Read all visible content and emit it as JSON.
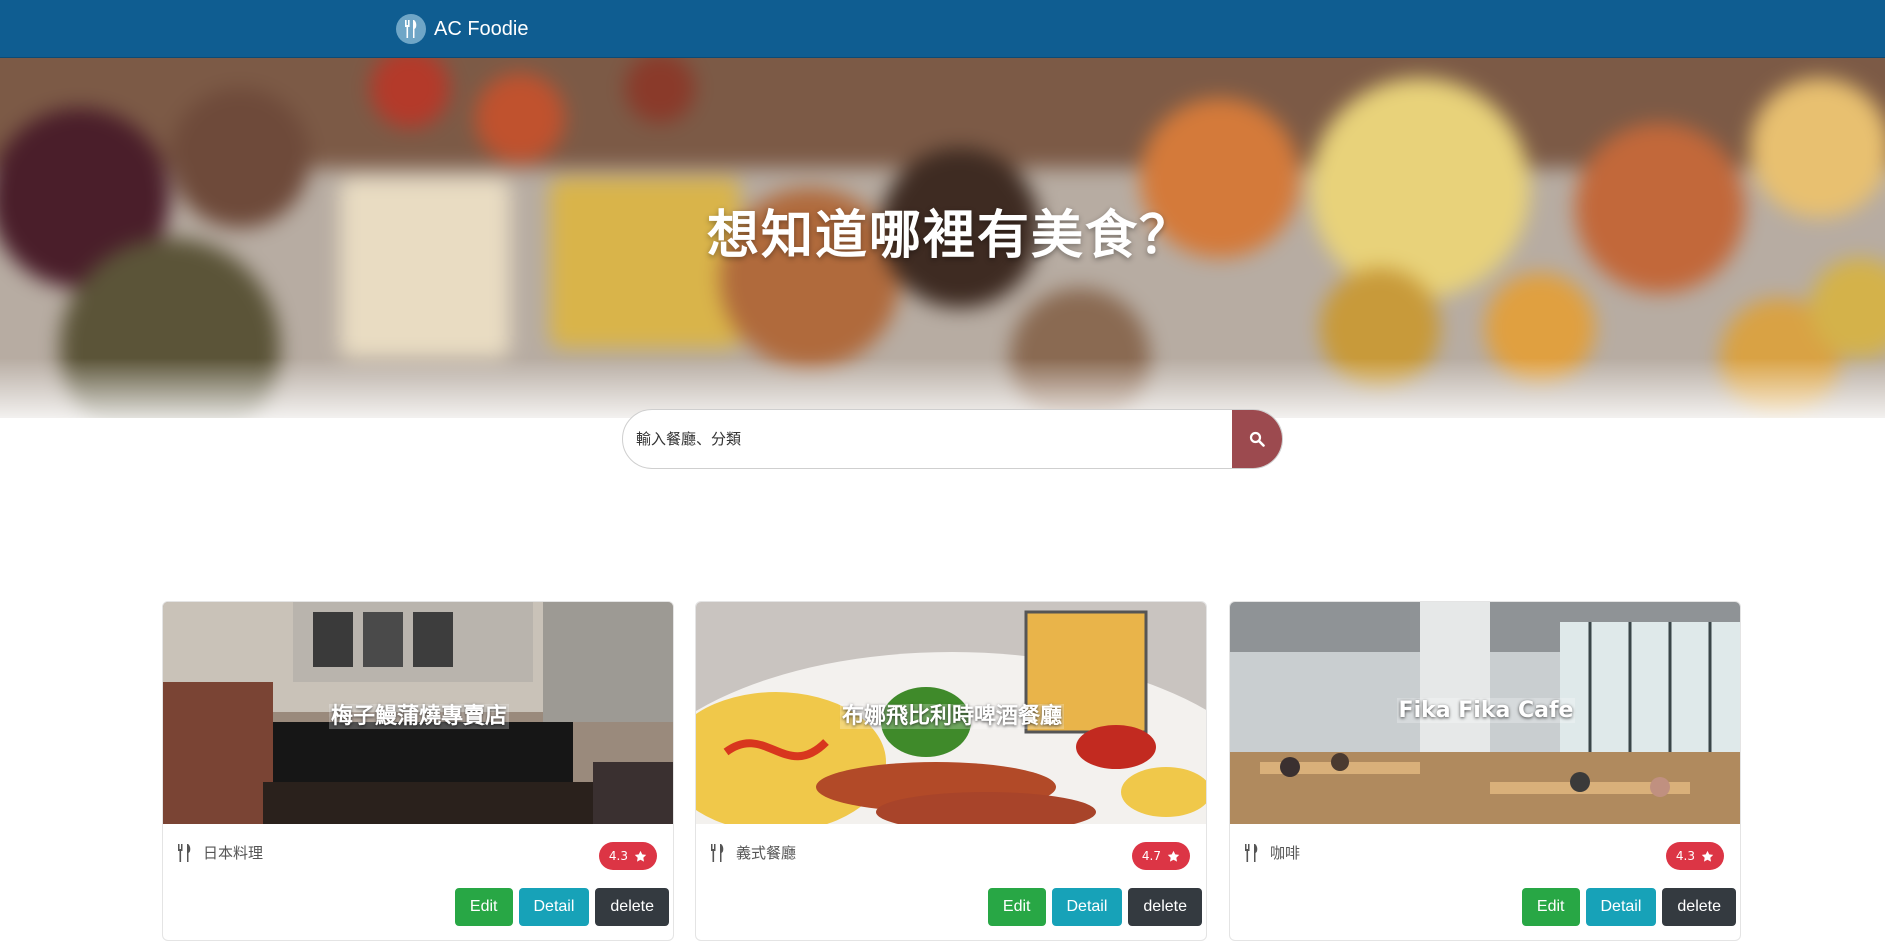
{
  "navbar": {
    "brand": "AC Foodie",
    "brand_icon": "utensils-icon",
    "color": "#0f5d91"
  },
  "hero": {
    "title": "想知道哪裡有美食？"
  },
  "search": {
    "placeholder": "輸入餐廳、分類",
    "button_icon": "search-icon",
    "button_color": "#9c4a4f"
  },
  "restaurants": [
    {
      "name": "梅子鰻蒲燒專賣店",
      "category": "日本料理",
      "rating": "4.3"
    },
    {
      "name": "布娜飛比利時啤酒餐廳",
      "category": "義式餐廳",
      "rating": "4.7"
    },
    {
      "name": "Fika Fika Cafe",
      "category": "咖啡",
      "rating": "4.3"
    }
  ],
  "buttons": {
    "edit": "Edit",
    "detail": "Detail",
    "delete": "delete"
  },
  "colors": {
    "edit": "#28a745",
    "detail": "#17a2b8",
    "delete": "#343a40",
    "rating": "#dc3545"
  }
}
